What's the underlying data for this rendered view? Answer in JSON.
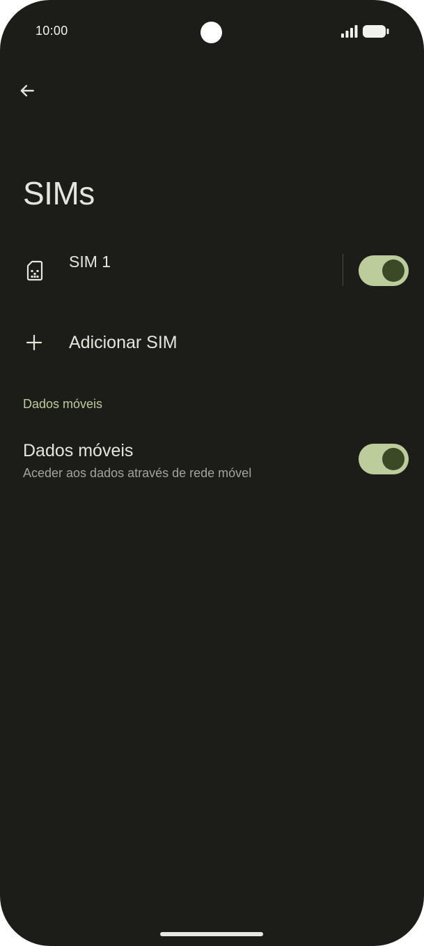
{
  "status_bar": {
    "time": "10:00",
    "signal_icon": "cellular-signal-icon",
    "battery_icon": "battery-full-icon"
  },
  "header": {
    "back_icon": "arrow-back-icon",
    "title": "SIMs"
  },
  "sim_list": {
    "items": [
      {
        "label": "SIM 1",
        "icon": "sim-card-icon",
        "enabled": true
      }
    ]
  },
  "add_sim": {
    "icon": "plus-icon",
    "label": "Adicionar SIM"
  },
  "mobile_data_section": {
    "header": "Dados móveis",
    "title": "Dados móveis",
    "subtitle": "Aceder aos dados através de rede móvel",
    "enabled": true
  },
  "colors": {
    "background": "#1c1d18",
    "accent": "#bccc9b",
    "toggle_knob": "#3b4a26",
    "primary_text": "#e6e5dc",
    "secondary_text": "#a3a39a"
  }
}
